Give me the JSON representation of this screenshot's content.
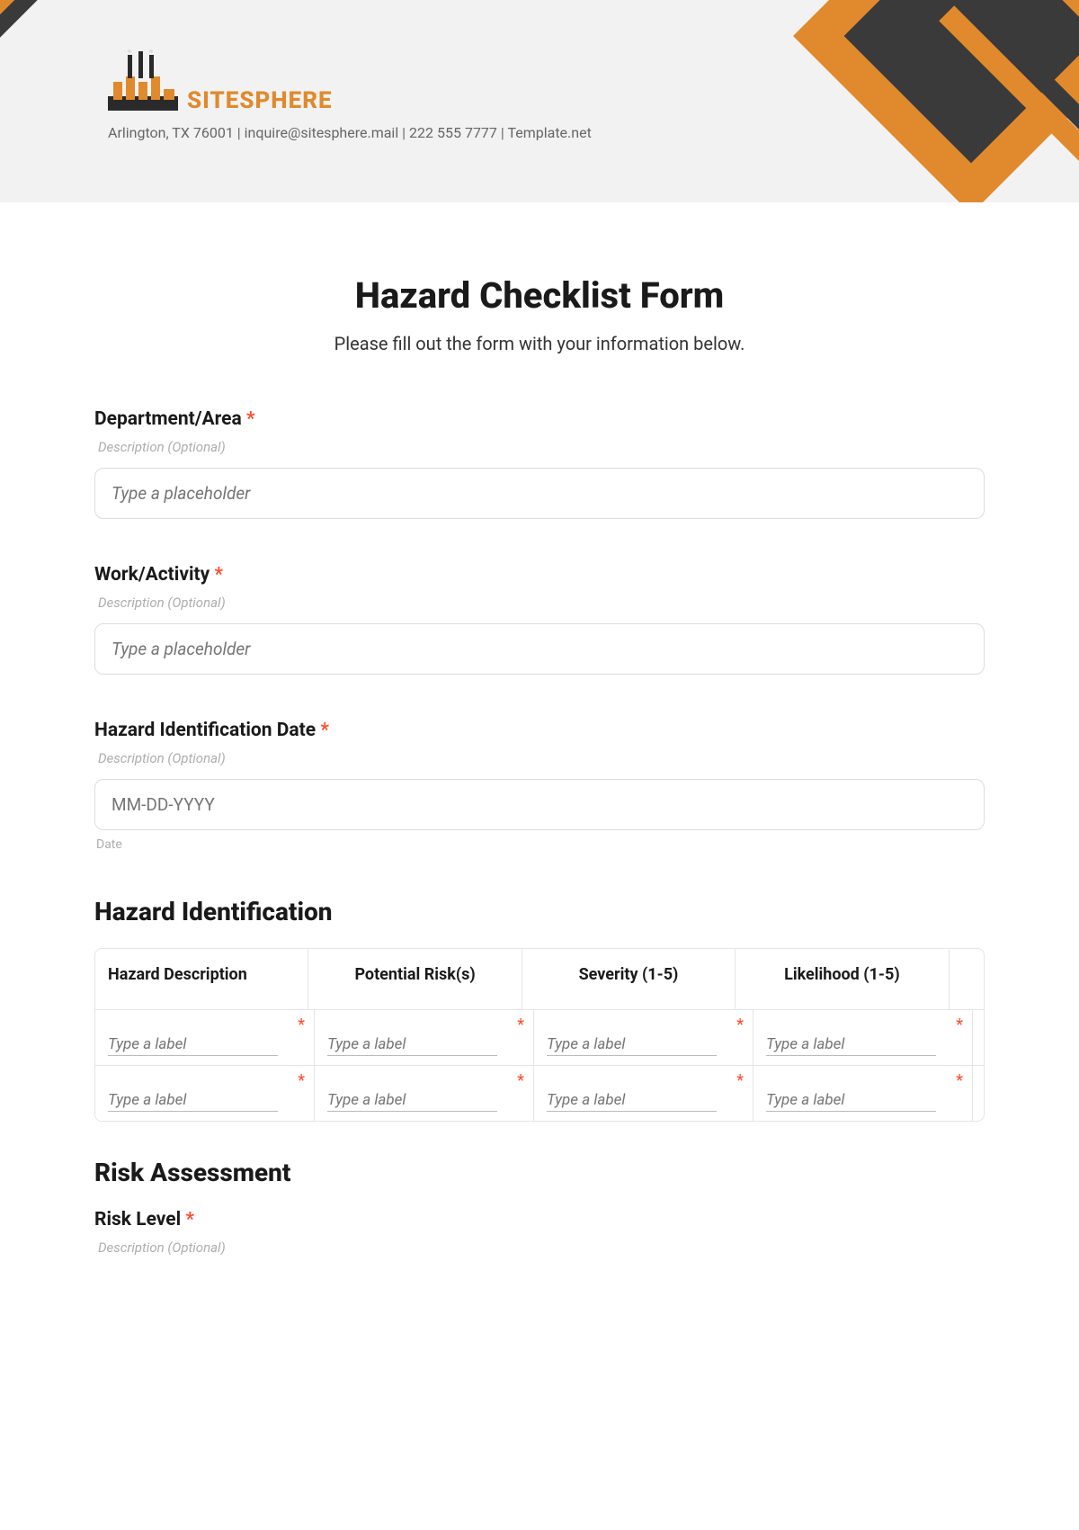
{
  "header": {
    "brand": "SITESPHERE",
    "contact": "Arlington, TX 76001 | inquire@sitesphere.mail | 222 555 7777 | Template.net"
  },
  "form": {
    "title": "Hazard Checklist Form",
    "subtitle": "Please fill out the form with your information below.",
    "required_mark": "*",
    "fields": {
      "department": {
        "label": "Department/Area",
        "desc": "Description (Optional)",
        "placeholder": "Type a placeholder"
      },
      "work": {
        "label": "Work/Activity",
        "desc": "Description (Optional)",
        "placeholder": "Type a placeholder"
      },
      "date": {
        "label": "Hazard Identification Date",
        "desc": "Description (Optional)",
        "placeholder": "MM-DD-YYYY",
        "sublabel": "Date"
      }
    },
    "section_hazard": {
      "heading": "Hazard Identification",
      "columns": [
        "Hazard Description",
        "Potential Risk(s)",
        "Severity (1-5)",
        "Likelihood (1-5)"
      ],
      "cell_placeholder": "Type a label"
    },
    "section_risk": {
      "heading": "Risk Assessment",
      "risk_level_label": "Risk Level",
      "desc": "Description (Optional)"
    }
  }
}
